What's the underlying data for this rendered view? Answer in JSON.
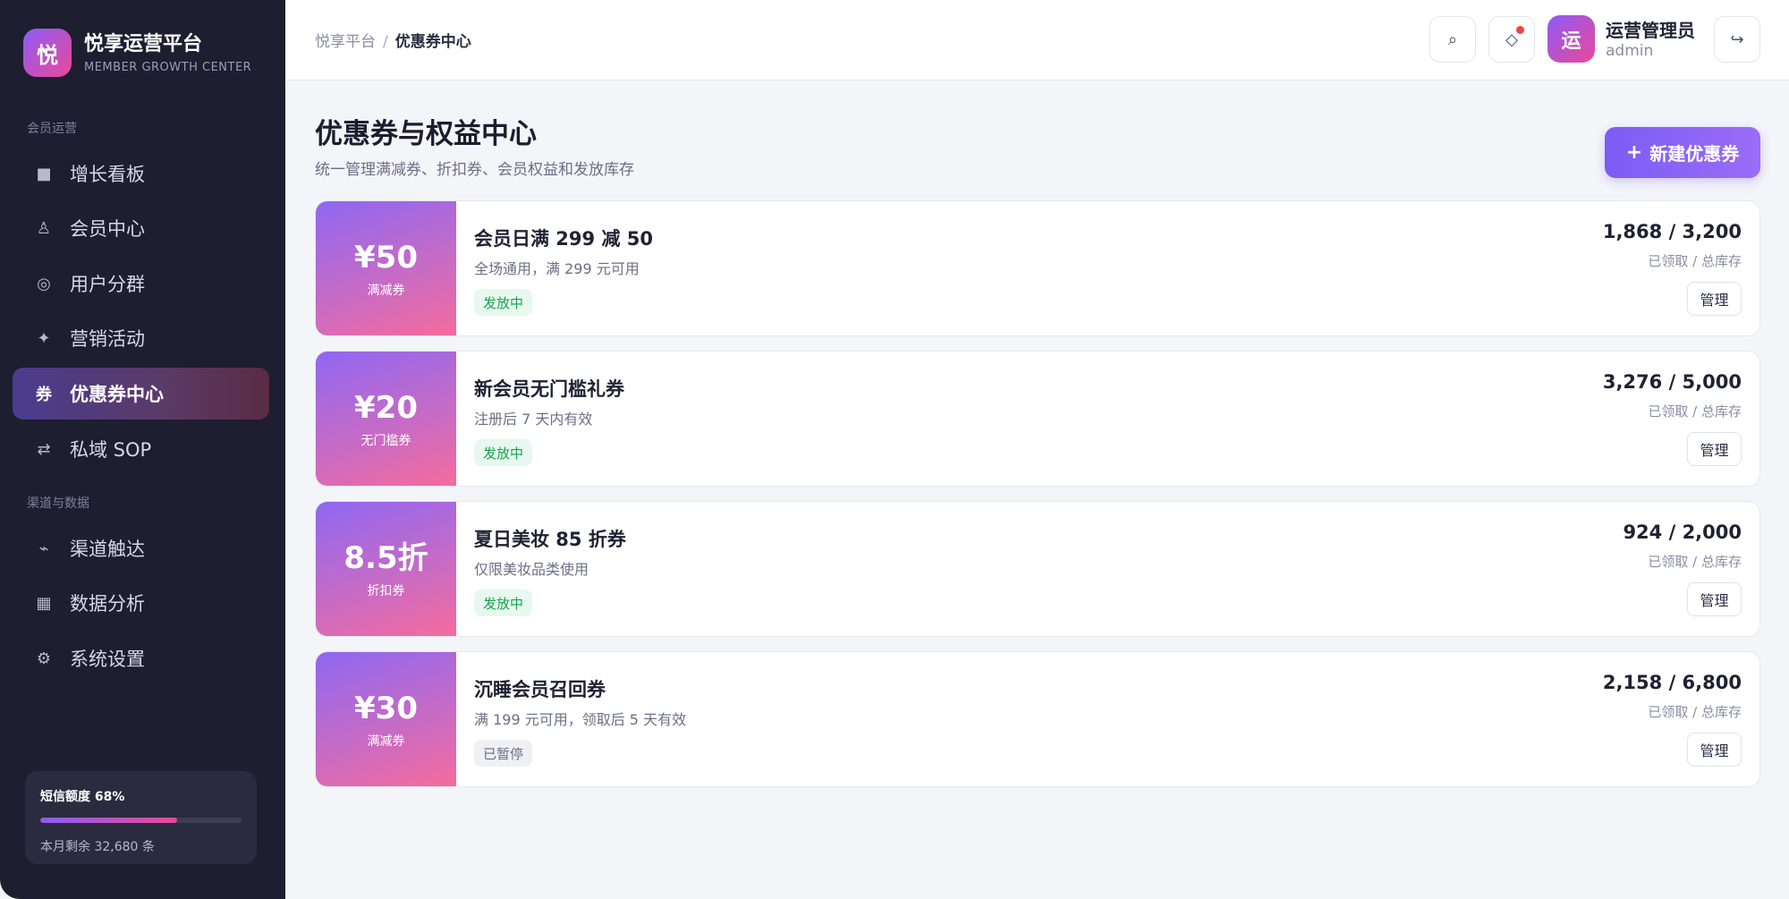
{
  "brand": {
    "logo": "悦",
    "title": "悦享运营平台",
    "subtitle": "MEMBER GROWTH CENTER"
  },
  "sidebar": {
    "section1": "会员运营",
    "section2": "渠道与数据",
    "items": [
      {
        "icon": "dashboard-icon",
        "glyph": "■",
        "label": "增长看板"
      },
      {
        "icon": "member-icon",
        "glyph": "♙",
        "label": "会员中心"
      },
      {
        "icon": "segment-icon",
        "glyph": "◎",
        "label": "用户分群"
      },
      {
        "icon": "sparkle-icon",
        "glyph": "✦",
        "label": "营销活动"
      },
      {
        "icon": "coupon-icon",
        "glyph": "券",
        "label": "优惠券中心"
      },
      {
        "icon": "swap-icon",
        "glyph": "⇄",
        "label": "私域 SOP"
      },
      {
        "icon": "signal-icon",
        "glyph": "⌁",
        "label": "渠道触达"
      },
      {
        "icon": "chart-icon",
        "glyph": "▦",
        "label": "数据分析"
      },
      {
        "icon": "gear-icon",
        "glyph": "⚙",
        "label": "系统设置"
      }
    ],
    "active_index": 4,
    "quota": {
      "title": "短信额度 68%",
      "percent": 68,
      "remain": "本月剩余 32,680 条"
    }
  },
  "topbar": {
    "breadcrumb_root": "悦享平台",
    "breadcrumb_sep": "/",
    "breadcrumb_current": "优惠券中心",
    "search_icon": "⌕",
    "notify_icon": "◇",
    "logout_icon": "↪",
    "user": {
      "avatar": "运",
      "name": "运营管理员",
      "role": "admin"
    }
  },
  "page": {
    "title": "优惠券与权益中心",
    "subtitle": "统一管理满减券、折扣券、会员权益和发放库存",
    "new_button_plus": "+",
    "new_button": "新建优惠券"
  },
  "coupons": [
    {
      "value": "¥50",
      "type": "满减券",
      "name": "会员日满 299 减 50",
      "desc": "全场通用，满 299 元可用",
      "status": "发放中",
      "status_kind": "active",
      "count": "1,868 / 3,200",
      "count_label": "已领取 / 总库存",
      "action": "管理"
    },
    {
      "value": "¥20",
      "type": "无门槛券",
      "name": "新会员无门槛礼券",
      "desc": "注册后 7 天内有效",
      "status": "发放中",
      "status_kind": "active",
      "count": "3,276 / 5,000",
      "count_label": "已领取 / 总库存",
      "action": "管理"
    },
    {
      "value": "8.5折",
      "type": "折扣券",
      "name": "夏日美妆 85 折券",
      "desc": "仅限美妆品类使用",
      "status": "发放中",
      "status_kind": "active",
      "count": "924 / 2,000",
      "count_label": "已领取 / 总库存",
      "action": "管理"
    },
    {
      "value": "¥30",
      "type": "满减券",
      "name": "沉睡会员召回券",
      "desc": "满 199 元可用，领取后 5 天有效",
      "status": "已暂停",
      "status_kind": "paused",
      "count": "2,158 / 6,800",
      "count_label": "已领取 / 总库存",
      "action": "管理"
    }
  ]
}
